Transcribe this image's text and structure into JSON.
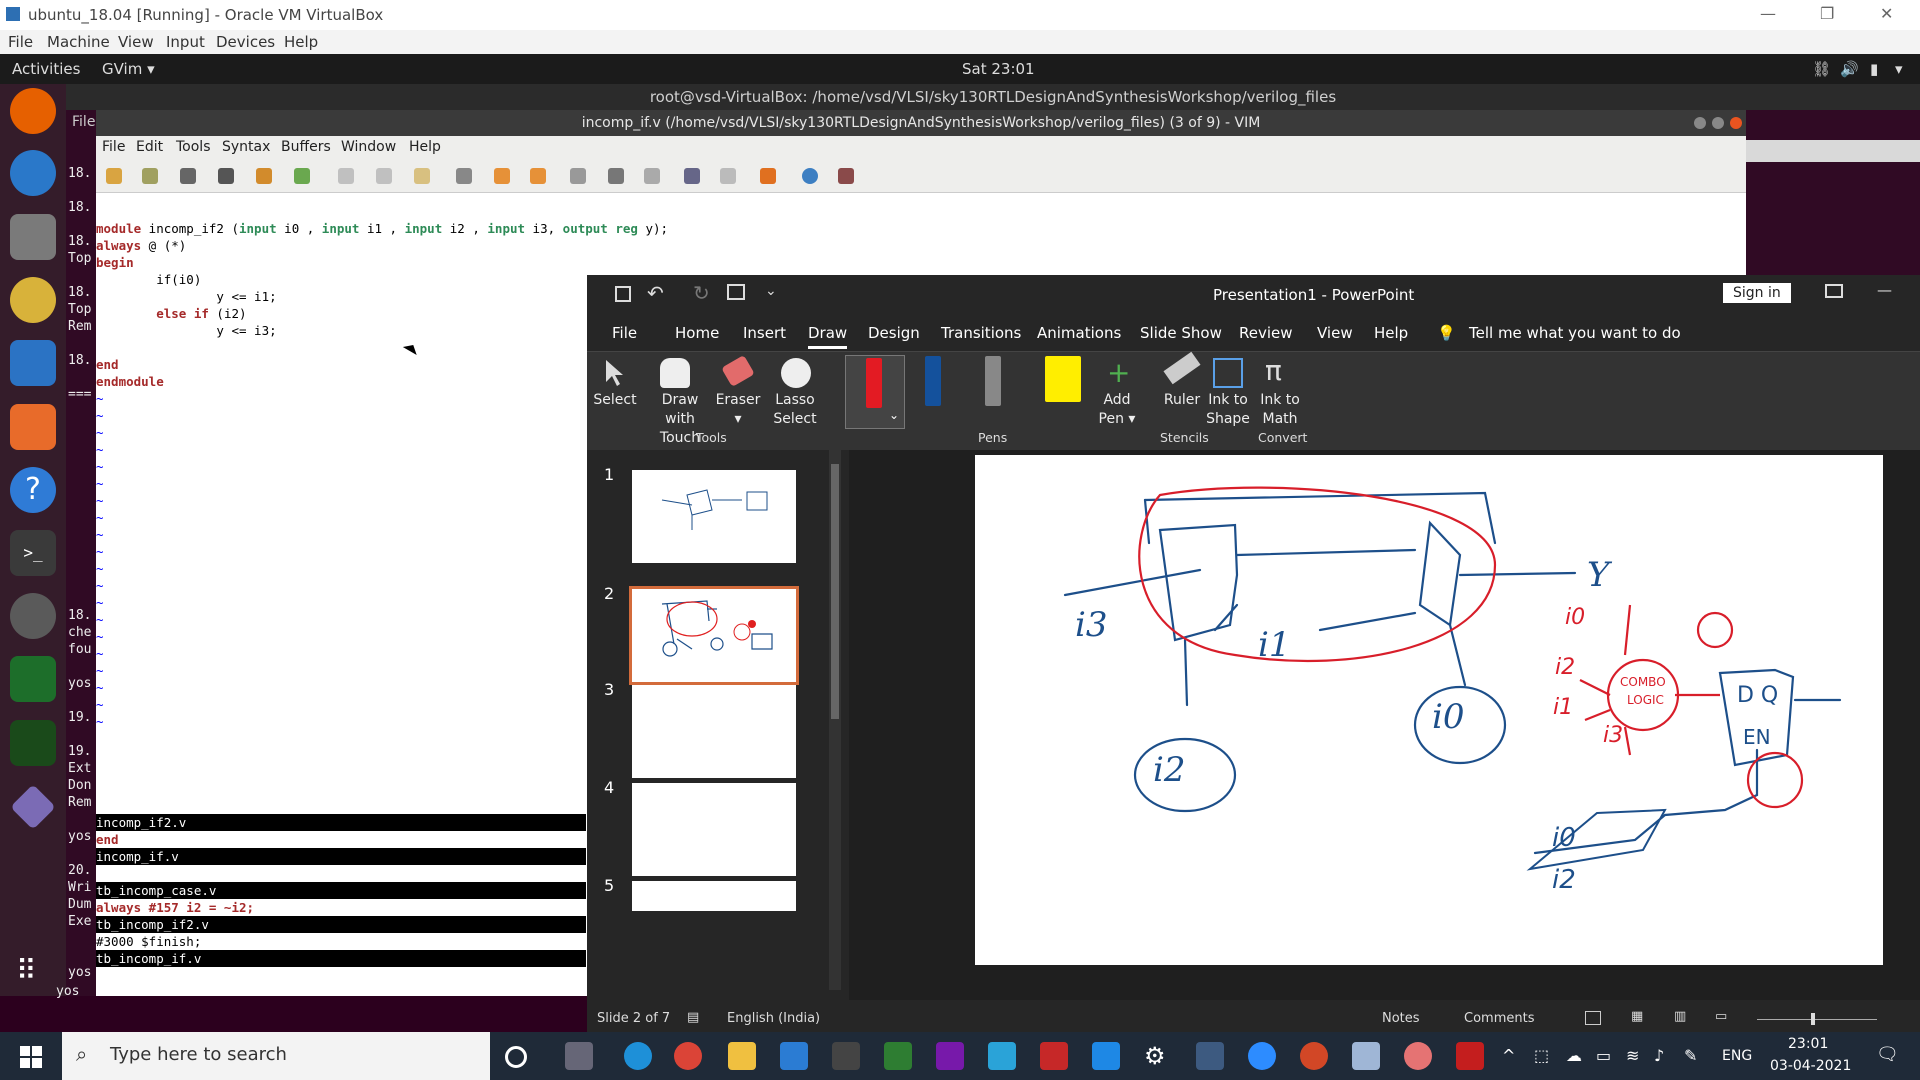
{
  "vbox": {
    "title": "ubuntu_18.04 [Running] - Oracle VM VirtualBox",
    "menu": [
      "File",
      "Machine",
      "View",
      "Input",
      "Devices",
      "Help"
    ]
  },
  "ubuntu": {
    "activities": "Activities",
    "app": "GVim ▾",
    "clock": "Sat 23:01"
  },
  "terminal": {
    "title": "root@vsd-VirtualBox: /home/vsd/VLSI/sky130RTLDesignAndSynthesisWorkshop/verilog_files",
    "file_menu": "File",
    "left_fragments": [
      "18.",
      "18.",
      "18.",
      "Top",
      "18.",
      "Top",
      "Rem",
      "18.",
      "===",
      "18.",
      "che",
      "fou",
      "yos",
      "19.",
      "19.",
      "Ext",
      "Don",
      "Rem",
      "yos",
      "20.",
      "Wri",
      "Dum",
      "Exe",
      "yos"
    ]
  },
  "gvim": {
    "title": "incomp_if.v (/home/vsd/VLSI/sky130RTLDesignAndSynthesisWorkshop/verilog_files) (3 of 9) - VIM",
    "menu": [
      "File",
      "Edit",
      "Tools",
      "Syntax",
      "Buffers",
      "Window",
      "Help"
    ],
    "code": {
      "l1_kw": "module",
      "l1_rest": " incomp_if2 (",
      "l1_in0": "input",
      "l1_a": " i0 , ",
      "l1_in1": "input",
      "l1_b": " i1 , ",
      "l1_in2": "input",
      "l1_c": " i2 , ",
      "l1_in3": "input",
      "l1_d": " i3, ",
      "l1_out": "output",
      "l1_e": " ",
      "l1_reg": "reg",
      "l1_f": " y);",
      "l2_kw": "always",
      "l2_rest": " @ (*)",
      "l3": "begin",
      "l4": "        if(i0)",
      "l5": "                y <= i1;",
      "l6_kw": "        else if",
      "l6_rest": " (i2)",
      "l7": "                y <= i3;",
      "l8": "end",
      "l9": "endmodule"
    },
    "buffers": [
      {
        "text": "incomp_if2.v",
        "style": "rev"
      },
      {
        "text": "end",
        "style": "kw"
      },
      {
        "text": "incomp_if.v",
        "style": "rev"
      },
      {
        "text": "",
        "style": "plain"
      },
      {
        "text": "tb_incomp_case.v",
        "style": "rev"
      },
      {
        "text": "always #157 i2 = ~i2;",
        "style": "kw"
      },
      {
        "text": "tb_incomp_if2.v",
        "style": "rev"
      },
      {
        "text": "        #3000 $finish;",
        "style": "plain"
      },
      {
        "text": "tb_incomp_if.v",
        "style": "rev"
      }
    ],
    "prompt": "yos"
  },
  "ppt": {
    "title": "Presentation1  -  PowerPoint",
    "sign_in": "Sign in",
    "tabs": [
      "File",
      "Home",
      "Insert",
      "Draw",
      "Design",
      "Transitions",
      "Animations",
      "Slide Show",
      "Review",
      "View",
      "Help"
    ],
    "tell_me": "Tell me what you want to do",
    "tools": [
      {
        "line1": "Select",
        "line2": ""
      },
      {
        "line1": "Draw with",
        "line2": "Touch"
      },
      {
        "line1": "Eraser",
        "line2": "▾"
      },
      {
        "line1": "Lasso",
        "line2": "Select"
      }
    ],
    "add_pen": {
      "line1": "Add",
      "line2": "Pen ▾"
    },
    "ruler": "Ruler",
    "ink_shape": {
      "line1": "Ink to",
      "line2": "Shape"
    },
    "ink_math": {
      "line1": "Ink to",
      "line2": "Math"
    },
    "groups": [
      "Tools",
      "Pens",
      "Stencils",
      "Convert"
    ],
    "slide_numbers": [
      "1",
      "2",
      "3",
      "4",
      "5"
    ],
    "status": {
      "slide": "Slide 2 of 7",
      "lang": "English (India)",
      "notes": "Notes",
      "comments": "Comments"
    },
    "ink_text": {
      "i3": "i3",
      "i1": "i1",
      "i2": "i2",
      "i0": "i0",
      "y": "Y",
      "combo": "COMBO",
      "logic": "LOGIC",
      "d": "D  Q",
      "en": "EN",
      "r_i0": "i0",
      "r_i2": "i2",
      "r_i1": "i1",
      "r_i3": "i3",
      "b_i0": "i0",
      "b_i2": "i2"
    }
  },
  "taskbar": {
    "search": "Type here to search",
    "lang": "ENG",
    "time": "23:01",
    "date": "03-04-2021"
  }
}
